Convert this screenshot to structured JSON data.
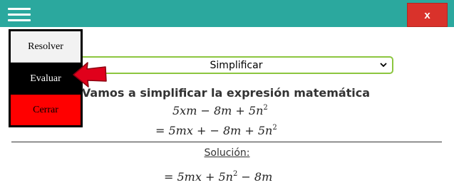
{
  "header": {
    "close_label": "x",
    "menu_icon": "hamburger-icon",
    "bar_color": "#2ba89e",
    "close_color": "#d9322b"
  },
  "menu": {
    "items": [
      {
        "label": "Resolver"
      },
      {
        "label": "Evaluar"
      },
      {
        "label": "Cerrar"
      }
    ]
  },
  "operation_select": {
    "selected": "Simplificar"
  },
  "content": {
    "heading": "Vamos a simplificar la expresión matemática",
    "solution_label": "Solución:"
  },
  "expressions": {
    "line1": {
      "main": "5xm − 8m + 5n",
      "exp": "2"
    },
    "line2": {
      "main": "= 5mx + − 8m + 5n",
      "exp": "2"
    },
    "line3": {
      "pre": "= 5mx + 5n",
      "exp": "2",
      "post": " − 8m"
    }
  }
}
